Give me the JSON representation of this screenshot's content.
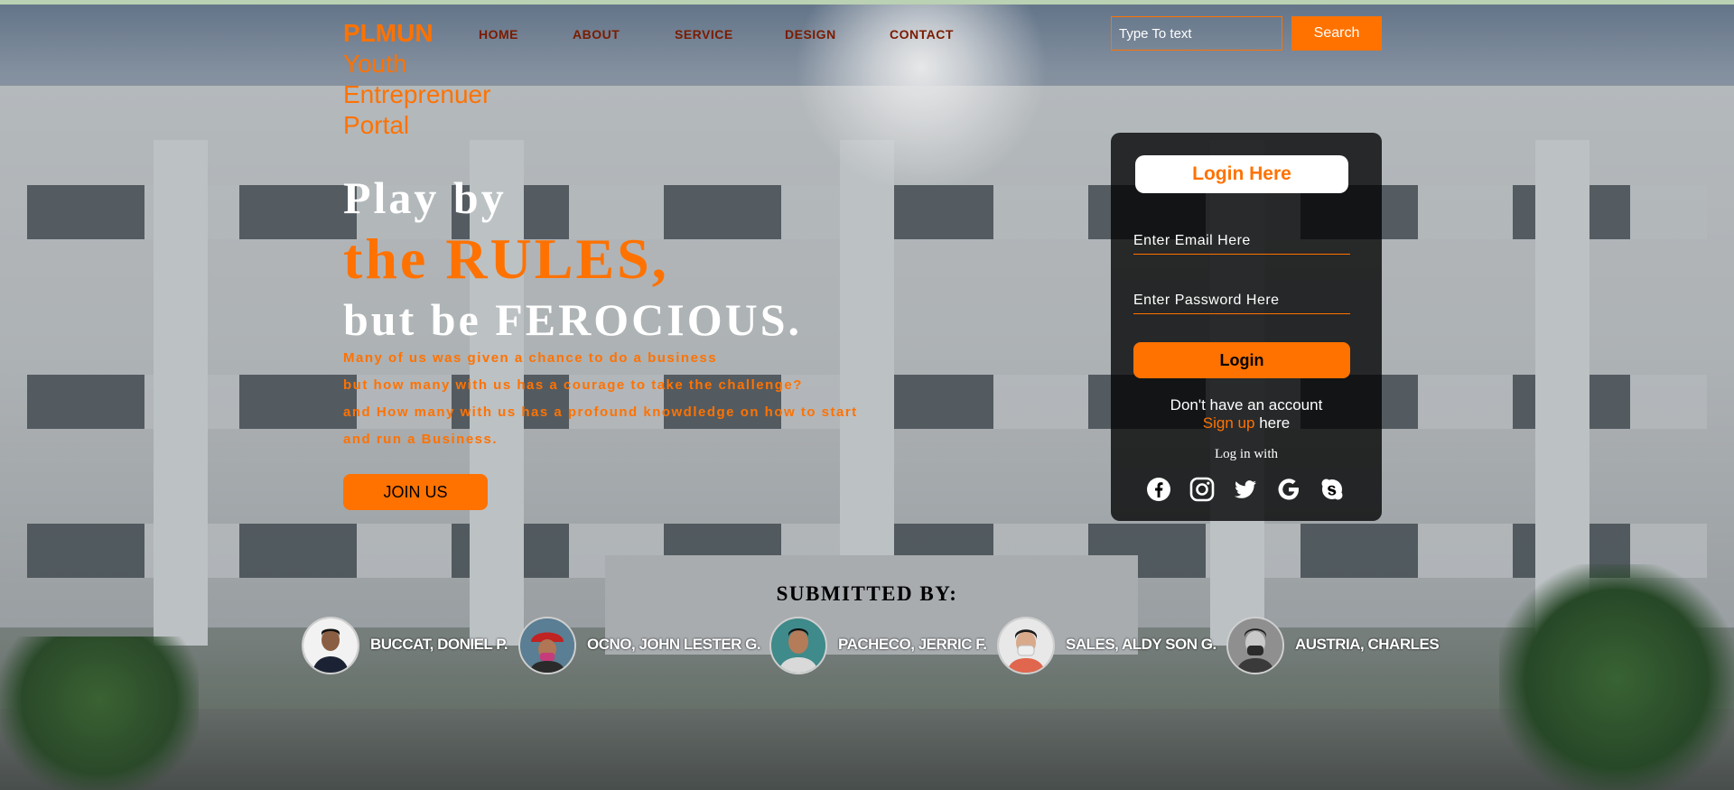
{
  "brand": {
    "words": [
      "PLMUN",
      "Youth",
      "Entreprenuer",
      "Portal"
    ]
  },
  "nav": {
    "items": [
      "HOME",
      "ABOUT",
      "SERVICE",
      "DESIGN",
      "CONTACT"
    ]
  },
  "search": {
    "placeholder": "Type To text",
    "button": "Search"
  },
  "hero": {
    "line1": "Play by",
    "line2": "the RULES,",
    "line3": "but be FEROCIOUS.",
    "paragraph": [
      "Many of us was given a chance to do a business",
      "but how many with us has a courage to take the challenge?",
      "and How many with us has a profound knowdledge on how to start",
      "and run a Business."
    ],
    "join_button": "JOIN US"
  },
  "login": {
    "title": "Login Here",
    "email_placeholder": "Enter Email Here",
    "password_placeholder": "Enter Password Here",
    "button": "Login",
    "no_account": "Don't have an account",
    "signup_link": "Sign up",
    "signup_suffix": "here",
    "login_with": "Log in with",
    "social_icons": [
      "facebook-icon",
      "instagram-icon",
      "twitter-icon",
      "google-icon",
      "skype-icon"
    ]
  },
  "submitted": {
    "heading": "SUBMITTED BY:",
    "members": [
      "BUCCAT, DONIEL P.",
      "OCNO, JOHN LESTER G.",
      "PACHECO, JERRIC F.",
      "SALES, ALDY SON G.",
      "AUSTRIA, CHARLES"
    ]
  },
  "colors": {
    "accent": "#ff7200",
    "nav_text": "#7a1b00",
    "panel": "#000000"
  }
}
